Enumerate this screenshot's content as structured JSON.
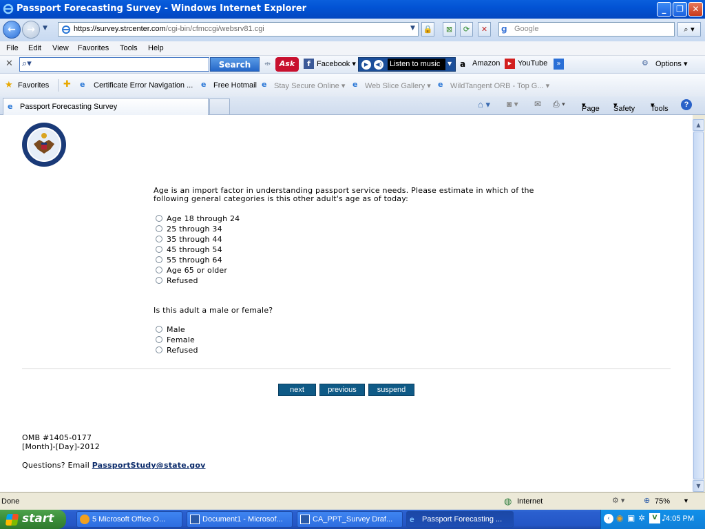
{
  "window": {
    "title": "Passport Forecasting Survey - Windows Internet Explorer"
  },
  "address": {
    "url_prefix": "https://",
    "url_host": "survey.strcenter.com",
    "url_path": "/cgi-bin/cfmccgi/websrv81.cgi",
    "search_placeholder": "Google"
  },
  "menu": [
    "File",
    "Edit",
    "View",
    "Favorites",
    "Tools",
    "Help"
  ],
  "ask_toolbar": {
    "search_label": "Search",
    "facebook": "Facebook",
    "listen": "Listen to music",
    "amazon": "Amazon",
    "youtube": "YouTube",
    "options": "Options"
  },
  "favorites": {
    "label": "Favorites",
    "items": [
      "Certificate Error Navigation ...",
      "Free Hotmail",
      "Stay Secure Online",
      "Web Slice Gallery",
      "WildTangent ORB - Top G..."
    ]
  },
  "tab": {
    "label": "Passport Forecasting Survey"
  },
  "command_bar": {
    "page": "Page",
    "safety": "Safety",
    "tools": "Tools"
  },
  "survey": {
    "q1_line1": "Age is an import factor in understanding passport service needs. Please estimate in which of the",
    "q1_line2": "following general categories is this other adult's age as of today:",
    "q1_options": [
      "Age 18 through 24",
      "25 through 34",
      "35 through 44",
      "45 through 54",
      "55 through 64",
      "Age 65 or older",
      "Refused"
    ],
    "q2": "Is this adult a male or female?",
    "q2_options": [
      "Male",
      "Female",
      "Refused"
    ],
    "buttons": {
      "next": "next",
      "previous": "previous",
      "suspend": "suspend"
    },
    "omb": "OMB #1405-0177",
    "date": "[Month]-[Day]-2012",
    "questions_prefix": "Questions? Email ",
    "email": "PassportStudy@state.gov"
  },
  "status": {
    "text": "Done",
    "zone": "Internet",
    "zoom": "75%"
  },
  "taskbar": {
    "start": "start",
    "tasks": [
      "5 Microsoft Office O...",
      "Document1 - Microsof...",
      "CA_PPT_Survey Draf...",
      "Passport Forecasting ..."
    ],
    "clock": "4:05 PM"
  }
}
